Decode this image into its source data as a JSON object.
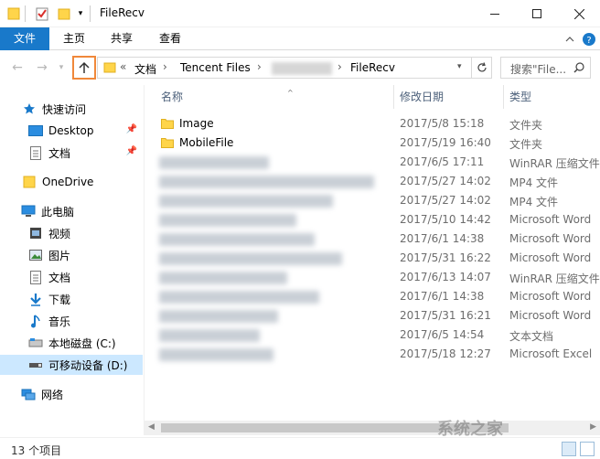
{
  "window": {
    "title": "FileRecv",
    "controls": [
      "minimize-icon",
      "maximize-icon",
      "close-icon"
    ]
  },
  "ribbon": {
    "tabs": [
      "文件",
      "主页",
      "共享",
      "查看"
    ]
  },
  "address": {
    "overflow": "«",
    "crumbs": [
      "文档",
      "Tencent Files",
      "FileRecv"
    ],
    "search_placeholder": "搜索\"File...",
    "icons": [
      "back-icon",
      "forward-icon",
      "recent-icon",
      "up-icon",
      "folder-icon",
      "refresh-icon",
      "search-icon"
    ]
  },
  "sidebar": {
    "quick_access": "快速访问",
    "desktop": "Desktop",
    "documents_quick": "文档",
    "onedrive": "OneDrive",
    "this_pc": "此电脑",
    "videos": "视频",
    "pictures": "图片",
    "documents": "文档",
    "downloads": "下载",
    "music": "音乐",
    "local_disk": "本地磁盘 (C:)",
    "removable": "可移动设备 (D:)",
    "network": "网络"
  },
  "list": {
    "columns": [
      "名称",
      "修改日期",
      "类型"
    ],
    "rows": [
      {
        "name": "Image",
        "date": "2017/5/8 15:18",
        "type": "文件夹"
      },
      {
        "name": "MobileFile",
        "date": "2017/5/19 16:40",
        "type": "文件夹"
      },
      {
        "name": "",
        "date": "2017/6/5 17:11",
        "type": "WinRAR 压缩文件"
      },
      {
        "name": "",
        "date": "2017/5/27 14:02",
        "type": "MP4 文件"
      },
      {
        "name": "",
        "date": "2017/5/27 14:02",
        "type": "MP4 文件"
      },
      {
        "name": "",
        "date": "2017/5/10 14:42",
        "type": "Microsoft Word"
      },
      {
        "name": "",
        "date": "2017/6/1 14:38",
        "type": "Microsoft Word"
      },
      {
        "name": "",
        "date": "2017/5/31 16:22",
        "type": "Microsoft Word"
      },
      {
        "name": "",
        "date": "2017/6/13 14:07",
        "type": "WinRAR 压缩文件"
      },
      {
        "name": "",
        "date": "2017/6/1 14:38",
        "type": "Microsoft Word"
      },
      {
        "name": "",
        "date": "2017/5/31 16:21",
        "type": "Microsoft Word"
      },
      {
        "name": "",
        "date": "2017/6/5 14:54",
        "type": "文本文档"
      },
      {
        "name": "",
        "date": "2017/5/18 12:27",
        "type": "Microsoft Excel"
      }
    ]
  },
  "status": {
    "count": "13 个项目"
  },
  "watermark": "系统之家",
  "colors": {
    "file_tab": "#1979ca",
    "selected": "#cce8ff",
    "up_highlight": "#f0883a",
    "folder": "#ffd54a"
  }
}
